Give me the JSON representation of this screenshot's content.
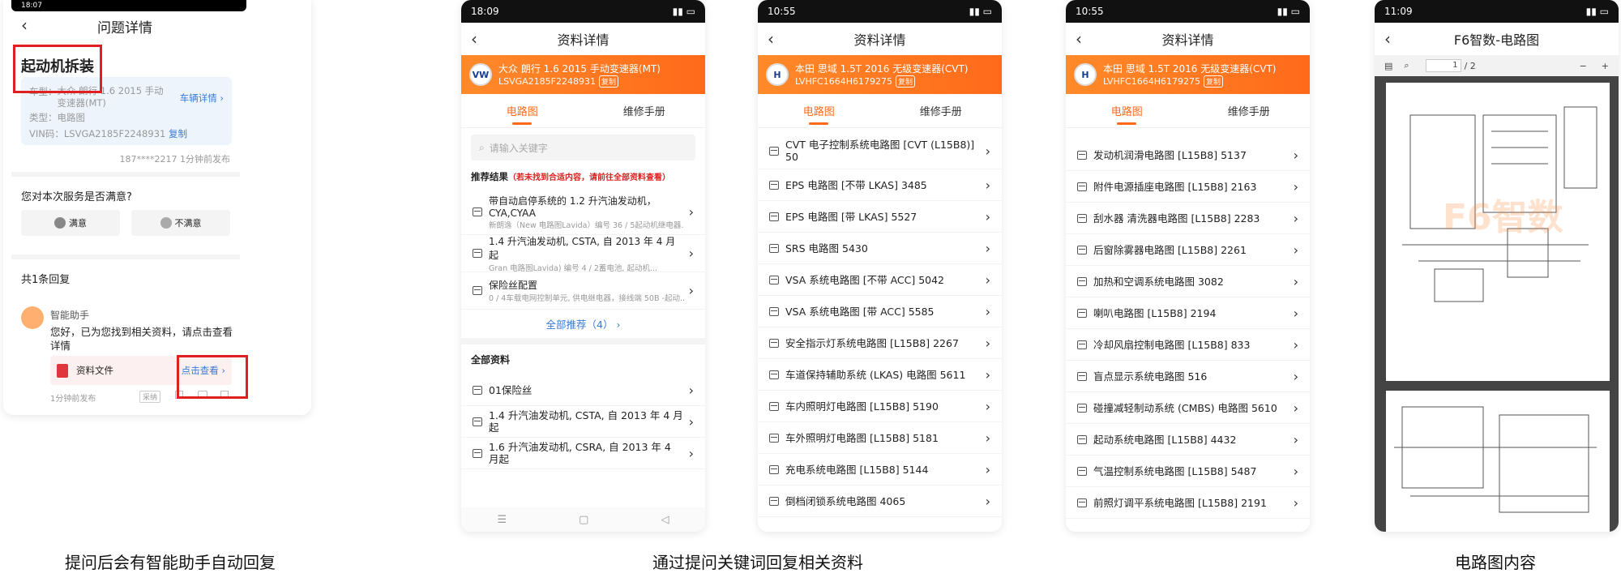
{
  "captions": [
    "提问后会有智能助手自动回复",
    "通过提问关键词回复相关资料",
    "电路图内容"
  ],
  "p1": {
    "status_time": "18:07",
    "title": "问题详情",
    "q_title": "起动机拆装",
    "car_label": "车型：",
    "car_value": "大众 朗行 1.6 2015 手动变速器(MT)",
    "car_link": "车辆详情",
    "type_label": "类型：",
    "type_value": "电路图",
    "vin_label": "VIN码：",
    "vin_value": "LSVGA2185F2248931",
    "copy": "复制",
    "meta": "187****2217 1分钟前发布",
    "survey_q": "您对本次服务是否满意?",
    "satisfied": "满意",
    "unsatisfied": "不满意",
    "reply_count": "共1条回复",
    "bot_name": "智能助手",
    "bot_text": "您好，已为您找到相关资料，请点击查看详情",
    "file_label": "资料文件",
    "view_link": "点击查看",
    "reply_time": "1分钟前发布",
    "adopt": "采纳"
  },
  "p2": {
    "status_time": "18:09",
    "title": "资料详情",
    "car": "大众 朗行 1.6 2015 手动变速器(MT)",
    "vin": "LSVGA2185F2248931",
    "copy": "复制",
    "tab1": "电路图",
    "tab2": "维修手册",
    "search_ph": "请输入关键字",
    "rec_title": "推荐结果",
    "rec_hint": "（若未找到合适内容，请前往全部资料查看）",
    "recs": [
      {
        "title": "带自动启停系统的 1.2 升汽油发动机，CYA,CYAA",
        "sub": "新朗逸（New 电路图Lavida）编号 36 / 5起动机继电器..."
      },
      {
        "title": "1.4 升汽油发动机, CSTA, 自 2013 年 4 月起",
        "sub": "Gran 电路图Lavida)  编号 4 / 2蓄电池, 起动机..."
      },
      {
        "title": "保险丝配置",
        "sub": "0 / 4车载电网控制单元, 供电继电器，接线端 50B -起动..."
      }
    ],
    "rec_more": "全部推荐（4）",
    "all_title": "全部资料",
    "all": [
      "01保险丝",
      "1.4 升汽油发动机, CSTA, 自 2013 年 4 月起",
      "1.6 升汽油发动机, CSRA, 自 2013 年 4 月起"
    ]
  },
  "p3": {
    "status_time": "10:55",
    "title": "资料详情",
    "car": "本田 思域 1.5T 2016 无级变速器(CVT)",
    "vin": "LVHFC1664H6179275",
    "copy": "复制",
    "tab1": "电路图",
    "tab2": "维修手册",
    "items": [
      "CVT 电子控制系统电路图 [CVT (L15B8)] 50",
      "EPS 电路图 [不带 LKAS] 3485",
      "EPS 电路图 [带 LKAS] 5527",
      "SRS 电路图 5430",
      "VSA 系统电路图 [不带 ACC] 5042",
      "VSA 系统电路图 [带 ACC] 5585",
      "安全指示灯系统电路图 [L15B8] 2267",
      "车道保持辅助系统 (LKAS) 电路图 5611",
      "车内照明灯电路图 [L15B8] 5190",
      "车外照明灯电路图 [L15B8] 5181",
      "充电系统电路图 [L15B8] 5144",
      "倒档闭锁系统电路图 4065"
    ]
  },
  "p4": {
    "status_time": "10:55",
    "title": "资料详情",
    "car": "本田 思域 1.5T 2016 无级变速器(CVT)",
    "vin": "LVHFC1664H6179275",
    "copy": "复制",
    "tab1": "电路图",
    "tab2": "维修手册",
    "items": [
      "发动机润滑电路图 [L15B8] 5137",
      "附件电源插座电路图 [L15B8] 2163",
      "刮水器 清洗器电路图 [L15B8] 2283",
      "后窗除雾器电路图 [L15B8] 2261",
      "加热和空调系统电路图 3082",
      "喇叭电路图 [L15B8] 2194",
      "冷却风扇控制电路图 [L15B8] 833",
      "盲点显示系统电路图 516",
      "碰撞减轻制动系统 (CMBS) 电路图 5610",
      "起动系统电路图 [L15B8] 4432",
      "气温控制系统电路图 [L15B8] 5487",
      "前照灯调平系统电路图 [L15B8] 2191"
    ]
  },
  "p5": {
    "status_time": "11:09",
    "title": "F6智数-电路图",
    "page_input": "1",
    "page_total": "/ 2",
    "zoom_out": "−",
    "zoom_in": "+",
    "watermark": "F6智数"
  },
  "colors": {
    "accent": "#ff6a1a",
    "link": "#3a7bd5",
    "red": "#e02020"
  }
}
